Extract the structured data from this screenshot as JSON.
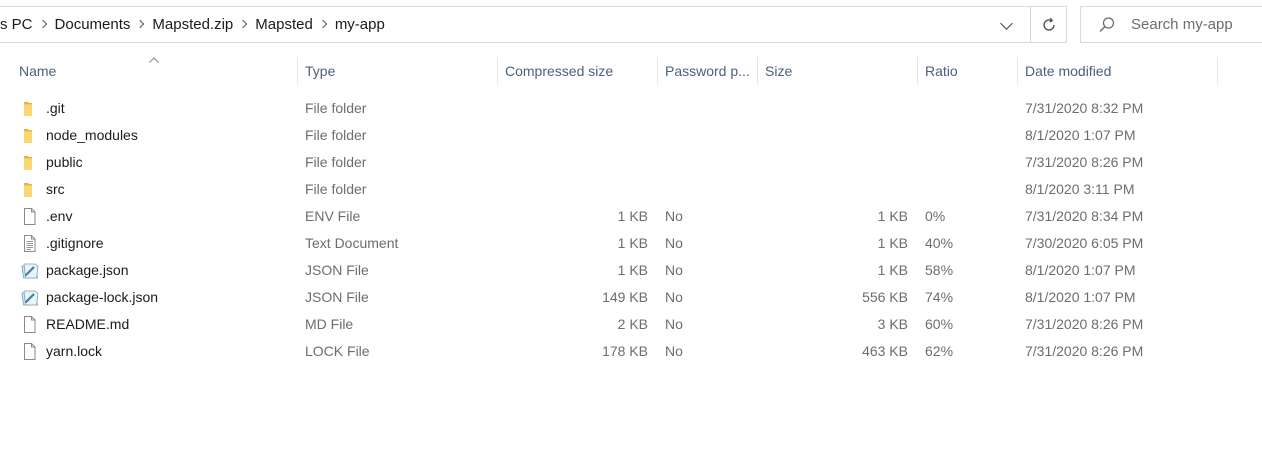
{
  "address_bar": {
    "crumbs": [
      "s PC",
      "Documents",
      "Mapsted.zip",
      "Mapsted",
      "my-app"
    ]
  },
  "search": {
    "placeholder": "Search my-app"
  },
  "columns": {
    "name": "Name",
    "type": "Type",
    "compressed_size": "Compressed size",
    "password": "Password p...",
    "size": "Size",
    "ratio": "Ratio",
    "date_modified": "Date modified"
  },
  "files": [
    {
      "name": ".git",
      "type": "File folder",
      "compressed_size": "",
      "password": "",
      "size": "",
      "ratio": "",
      "date": "7/31/2020 8:32 PM",
      "icon": "folder-icon"
    },
    {
      "name": "node_modules",
      "type": "File folder",
      "compressed_size": "",
      "password": "",
      "size": "",
      "ratio": "",
      "date": "8/1/2020 1:07 PM",
      "icon": "folder-icon"
    },
    {
      "name": "public",
      "type": "File folder",
      "compressed_size": "",
      "password": "",
      "size": "",
      "ratio": "",
      "date": "7/31/2020 8:26 PM",
      "icon": "folder-icon"
    },
    {
      "name": "src",
      "type": "File folder",
      "compressed_size": "",
      "password": "",
      "size": "",
      "ratio": "",
      "date": "8/1/2020 3:11 PM",
      "icon": "folder-icon"
    },
    {
      "name": ".env",
      "type": "ENV File",
      "compressed_size": "1 KB",
      "password": "No",
      "size": "1 KB",
      "ratio": "0%",
      "date": "7/31/2020 8:34 PM",
      "icon": "blank-file-icon"
    },
    {
      "name": ".gitignore",
      "type": "Text Document",
      "compressed_size": "1 KB",
      "password": "No",
      "size": "1 KB",
      "ratio": "40%",
      "date": "7/30/2020 6:05 PM",
      "icon": "text-file-icon"
    },
    {
      "name": "package.json",
      "type": "JSON File",
      "compressed_size": "1 KB",
      "password": "No",
      "size": "1 KB",
      "ratio": "58%",
      "date": "8/1/2020 1:07 PM",
      "icon": "json-file-icon"
    },
    {
      "name": "package-lock.json",
      "type": "JSON File",
      "compressed_size": "149 KB",
      "password": "No",
      "size": "556 KB",
      "ratio": "74%",
      "date": "8/1/2020 1:07 PM",
      "icon": "json-file-icon"
    },
    {
      "name": "README.md",
      "type": "MD File",
      "compressed_size": "2 KB",
      "password": "No",
      "size": "3 KB",
      "ratio": "60%",
      "date": "7/31/2020 8:26 PM",
      "icon": "blank-file-icon"
    },
    {
      "name": "yarn.lock",
      "type": "LOCK File",
      "compressed_size": "178 KB",
      "password": "No",
      "size": "463 KB",
      "ratio": "62%",
      "date": "7/31/2020 8:26 PM",
      "icon": "blank-file-icon"
    }
  ],
  "colors": {
    "header_text": "#4c607a",
    "folder_yellow": "#f8d775",
    "secondary_text": "#6d6d6d"
  }
}
